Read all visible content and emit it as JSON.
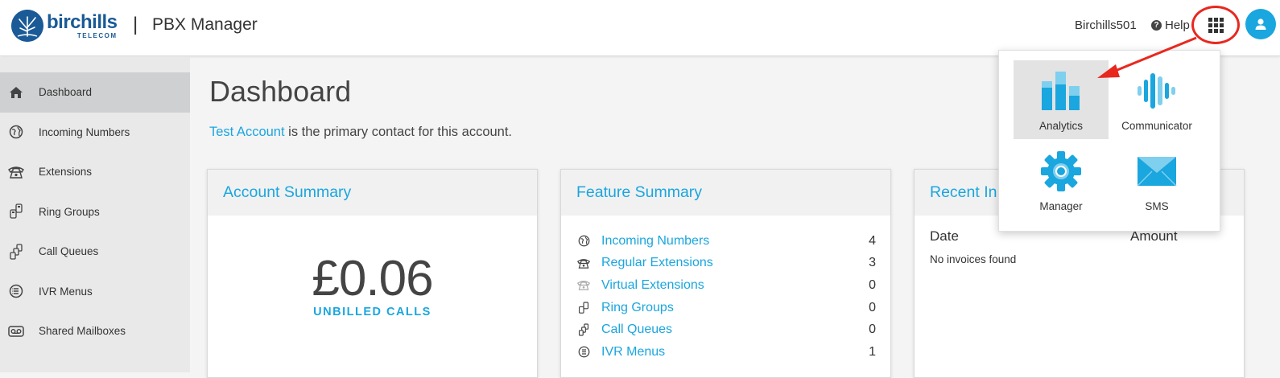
{
  "header": {
    "logo_name": "birchills",
    "logo_sub": "TELECOM",
    "separator": "|",
    "app_title": "PBX Manager",
    "username": "Birchills501",
    "help_label": "Help"
  },
  "sidebar": {
    "items": [
      {
        "label": "Dashboard",
        "icon": "home-icon"
      },
      {
        "label": "Incoming Numbers",
        "icon": "globe-icon"
      },
      {
        "label": "Extensions",
        "icon": "phone-icon"
      },
      {
        "label": "Ring Groups",
        "icon": "ring-group-icon"
      },
      {
        "label": "Call Queues",
        "icon": "call-queue-icon"
      },
      {
        "label": "IVR Menus",
        "icon": "ivr-icon"
      },
      {
        "label": "Shared Mailboxes",
        "icon": "voicemail-icon"
      }
    ]
  },
  "main": {
    "title": "Dashboard",
    "contact_name": "Test Account",
    "contact_suffix": " is the primary contact for this account."
  },
  "account_summary": {
    "title": "Account Summary",
    "amount": "£0.06",
    "amount_label": "UNBILLED CALLS"
  },
  "feature_summary": {
    "title": "Feature Summary",
    "items": [
      {
        "label": "Incoming Numbers",
        "count": "4"
      },
      {
        "label": "Regular Extensions",
        "count": "3"
      },
      {
        "label": "Virtual Extensions",
        "count": "0"
      },
      {
        "label": "Ring Groups",
        "count": "0"
      },
      {
        "label": "Call Queues",
        "count": "0"
      },
      {
        "label": "IVR Menus",
        "count": "1"
      }
    ]
  },
  "recent_invoices": {
    "title": "Recent In",
    "col_date": "Date",
    "col_amount": "Amount",
    "empty": "No invoices found"
  },
  "apps_menu": {
    "items": [
      {
        "label": "Analytics"
      },
      {
        "label": "Communicator"
      },
      {
        "label": "Manager"
      },
      {
        "label": "SMS"
      }
    ]
  },
  "colors": {
    "accent": "#1aa6de",
    "brand": "#1a5a96",
    "highlight": "#e8281f"
  }
}
